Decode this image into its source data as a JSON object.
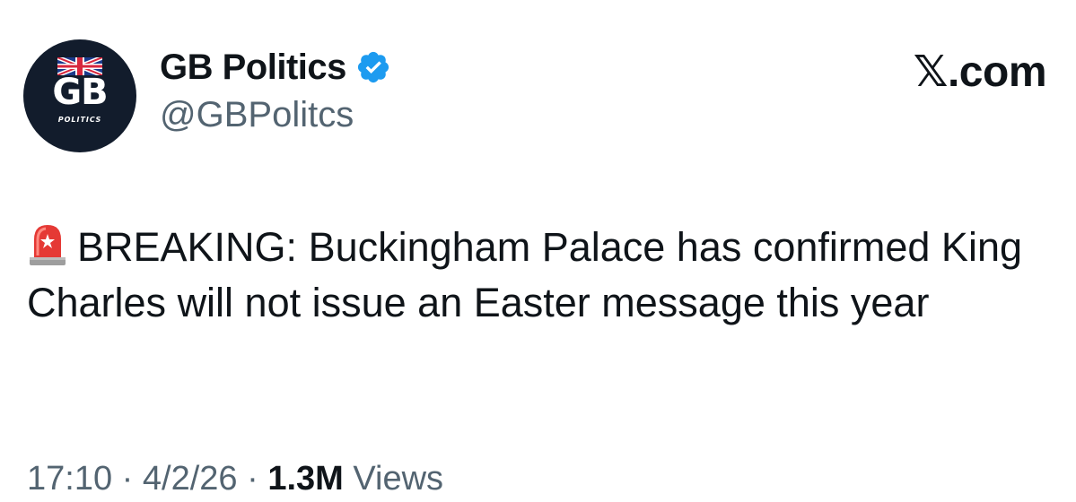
{
  "author": {
    "avatar_initials": "GB",
    "avatar_subtitle": "POLITICS",
    "avatar_icon": "union-jack-icon",
    "name": "GB Politics",
    "handle": "@GBPolitcs",
    "verified": true,
    "verified_icon": "verified-badge-icon"
  },
  "site_label": "𝕏.com",
  "tweet": {
    "prefix_icon": "police-siren-icon",
    "text": "BREAKING: Buckingham Palace has confirmed King Charles will not issue an Easter message this year"
  },
  "meta": {
    "time": "17:10",
    "separator": "·",
    "date": "4/2/26",
    "views_count": "1.3M",
    "views_label": "Views"
  },
  "colors": {
    "text_primary": "#0f1419",
    "text_secondary": "#536471",
    "verified_blue": "#1d9bf0",
    "avatar_bg": "#121c2c",
    "siren_red": "#e53935"
  }
}
